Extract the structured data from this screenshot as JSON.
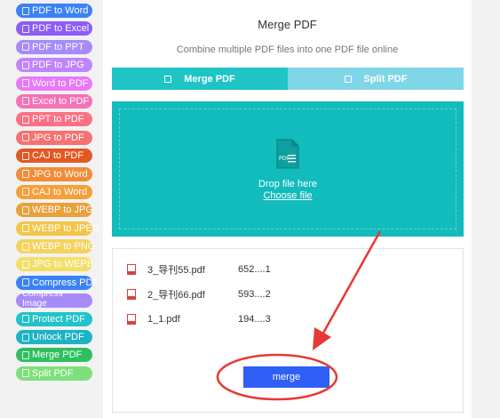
{
  "sidebar": {
    "items": [
      {
        "label": "PDF to Word",
        "color": "#3b82f6"
      },
      {
        "label": "PDF to Excel",
        "color": "#8b5cf6"
      },
      {
        "label": "PDF to PPT",
        "color": "#a78bfa"
      },
      {
        "label": "PDF to JPG",
        "color": "#c084fc"
      },
      {
        "label": "Word to PDF",
        "color": "#e879f9"
      },
      {
        "label": "Excel to PDF",
        "color": "#f472b6"
      },
      {
        "label": "PPT to PDF",
        "color": "#fb7185"
      },
      {
        "label": "JPG to PDF",
        "color": "#f87171"
      },
      {
        "label": "CAJ to PDF",
        "color": "#e25822"
      },
      {
        "label": "JPG to Word",
        "color": "#f28c38"
      },
      {
        "label": "CAJ to Word",
        "color": "#f5a03a"
      },
      {
        "label": "WEBP to JPG",
        "color": "#e9a13a"
      },
      {
        "label": "WEBP to JPEG",
        "color": "#f2c64a"
      },
      {
        "label": "WEBP to PNG",
        "color": "#f5d35e"
      },
      {
        "label": "JPG to WEPB",
        "color": "#f2df6a"
      },
      {
        "label": "Compress PDF",
        "color": "#3b82f6"
      },
      {
        "label": "Compress Image",
        "color": "#a78bfa"
      },
      {
        "label": "Protect PDF",
        "color": "#22c3c8"
      },
      {
        "label": "Unlock PDF",
        "color": "#1eb3c4"
      },
      {
        "label": "Merge PDF",
        "color": "#2fbf5f"
      },
      {
        "label": "Split PDF",
        "color": "#7ee07a"
      }
    ]
  },
  "main": {
    "title": "Merge PDF",
    "subtitle": "Combine multiple PDF files into one PDF file online",
    "tabs": [
      {
        "label": "Merge PDF",
        "active": true
      },
      {
        "label": "Split PDF",
        "active": false
      }
    ],
    "drop": {
      "icon": "pdf-file-icon",
      "icon_label": "PDF",
      "text": "Drop file here",
      "choose": "Choose file"
    },
    "files": [
      {
        "name": "3_导刊55.pdf",
        "size": "652....1"
      },
      {
        "name": "2_导刊66.pdf",
        "size": "593....2"
      },
      {
        "name": "1_1.pdf",
        "size": "194....3"
      }
    ],
    "merge_label": "merge"
  },
  "colors": {
    "accent": "#12bcbc",
    "button": "#2f5ff5",
    "annotation": "#e53935"
  }
}
